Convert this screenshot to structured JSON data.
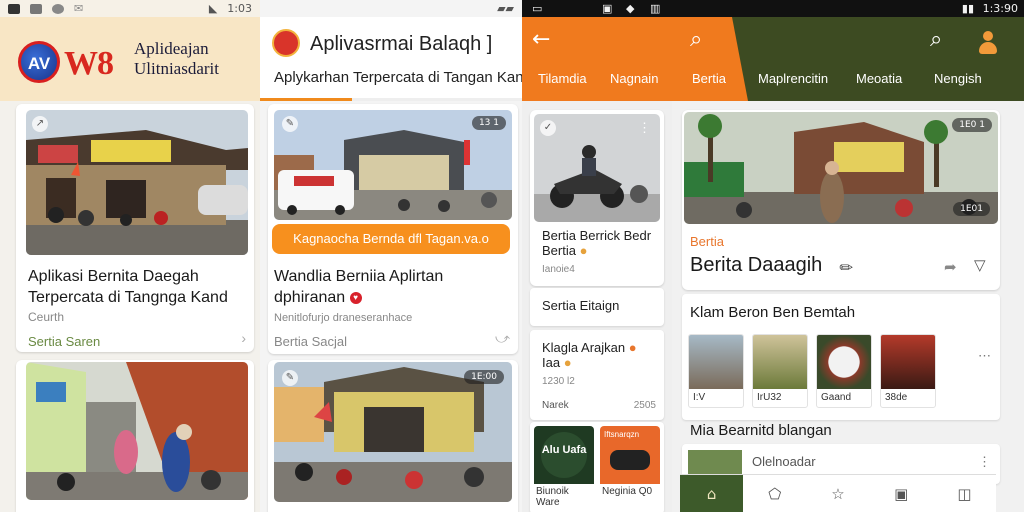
{
  "panel1": {
    "status": {
      "time": "1:03"
    },
    "logo": {
      "circle_text": "AV",
      "badge_text": "W8"
    },
    "header_title_line1": "Aplideajan",
    "header_title_line2": "Ulitniasdarit",
    "card1": {
      "headline_line1": "Aplikasi Bernita Daegah",
      "headline_line2": "Terpercata di Tangnga Kand",
      "sub": "Ceurth",
      "category": "Sertia Saren"
    }
  },
  "panel2": {
    "header_title": "Aplivasrmai Balaqh ]",
    "header_sub": "Aplykarhan Terpercata di Tangan Kand",
    "card1": {
      "pill": "13 1",
      "button": "Kagnaocha Bernda dfl Tagan.va.o",
      "headline_line1": "Wandlia Berniia Aplirtan",
      "headline_line2": "dphiranan",
      "sub": "Nenitlofurjo draneseranhace",
      "category": "Bertia Sacjal"
    },
    "card2": {
      "pill": "1E:00"
    }
  },
  "topnav": {
    "status_time": "1:3:90",
    "tabs": [
      "Tilamdia",
      "Nagnain",
      "Bertia",
      "Maplrencitin",
      "Meoatia",
      "Nengish"
    ]
  },
  "panel3": {
    "item1": {
      "title": "Bertia Berrick Bedr",
      "title2": "Bertia",
      "meta": "Ianoie4"
    },
    "item2": {
      "title": "Sertia Eitaign"
    },
    "item3": {
      "title": "Klagla Arajkan",
      "title2": "Iaa",
      "meta": "1230 l2",
      "sub": "Narek",
      "count": "2505"
    },
    "tiles": [
      {
        "badge": "Alu Uafa",
        "caption": "Biunoik Ware"
      },
      {
        "badge": "Iftsnarqzn",
        "caption": "Neginia Q0"
      }
    ]
  },
  "panel4": {
    "hero_pill": "1E0 1",
    "hero_pill2": "1E01",
    "category": "Bertia",
    "headline": "Berita Daaagih",
    "section_title": "Klam Beron Ben Bemtah",
    "grid": [
      {
        "caption": "I:V"
      },
      {
        "caption": "IrU32"
      },
      {
        "caption": "Gaand"
      },
      {
        "caption": "38de"
      }
    ],
    "section2_title": "Mia Bearnitd blangan",
    "list_item": "Olelnoadar"
  },
  "bottom_nav": [
    {
      "name": "home"
    },
    {
      "name": "explore"
    },
    {
      "name": "bookmark"
    },
    {
      "name": "notifications"
    },
    {
      "name": "profile"
    }
  ],
  "colors": {
    "accent_orange": "#f07a1e",
    "accent_green": "#3d4b22",
    "category_green": "#6a8a43"
  }
}
